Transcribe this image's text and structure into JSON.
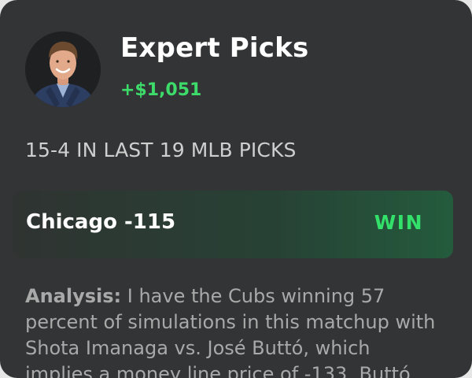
{
  "expert": {
    "title": "Expert Picks",
    "profit": "+$1,051",
    "avatar_icon": "expert-avatar-photo"
  },
  "record": "15-4 IN LAST 19 MLB PICKS",
  "pick": {
    "label": "Chicago -115",
    "result": "WIN"
  },
  "analysis": {
    "label": "Analysis:",
    "text": " I have the Cubs winning 57 percent of simulations in this matchup with Shota Imanaga vs. José Buttó, which implies a money line price of -133. Buttó"
  },
  "colors": {
    "card_background": "#333435",
    "profit_green": "#3ddc6a",
    "win_green": "#33e06a",
    "pick_gradient_end": "#245b3d"
  }
}
